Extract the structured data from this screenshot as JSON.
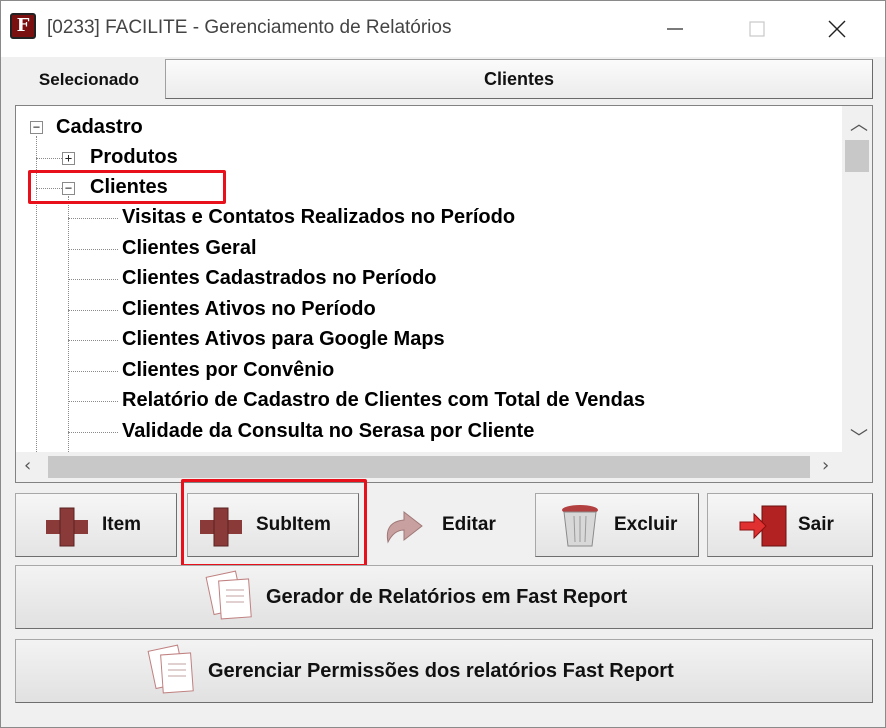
{
  "window": {
    "title": "[0233] FACILITE - Gerenciamento de Relatórios",
    "app_icon_letter": "F"
  },
  "selected": {
    "label": "Selecionado",
    "value": "Clientes"
  },
  "tree": {
    "root": {
      "label": "Cadastro",
      "expander": "−"
    },
    "produtos": {
      "label": "Produtos",
      "expander": "+"
    },
    "clientes": {
      "label": "Clientes",
      "expander": "−"
    },
    "children": [
      "Visitas e Contatos Realizados no Período",
      "Clientes Geral",
      "Clientes Cadastrados no Período",
      "Clientes Ativos no Período",
      "Clientes Ativos para Google Maps",
      "Clientes por Convênio",
      "Relatório de Cadastro de Clientes com Total de Vendas",
      "Validade da Consulta no Serasa por Cliente"
    ]
  },
  "buttons": {
    "item": "Item",
    "subitem": "SubItem",
    "editar": "Editar",
    "excluir": "Excluir",
    "sair": "Sair",
    "gerador": "Gerador de Relatórios em Fast Report",
    "permissoes": "Gerenciar Permissões dos relatórios Fast Report"
  },
  "colors": {
    "highlight": "#e8101a",
    "plus_icon": "#8b3a3a"
  }
}
